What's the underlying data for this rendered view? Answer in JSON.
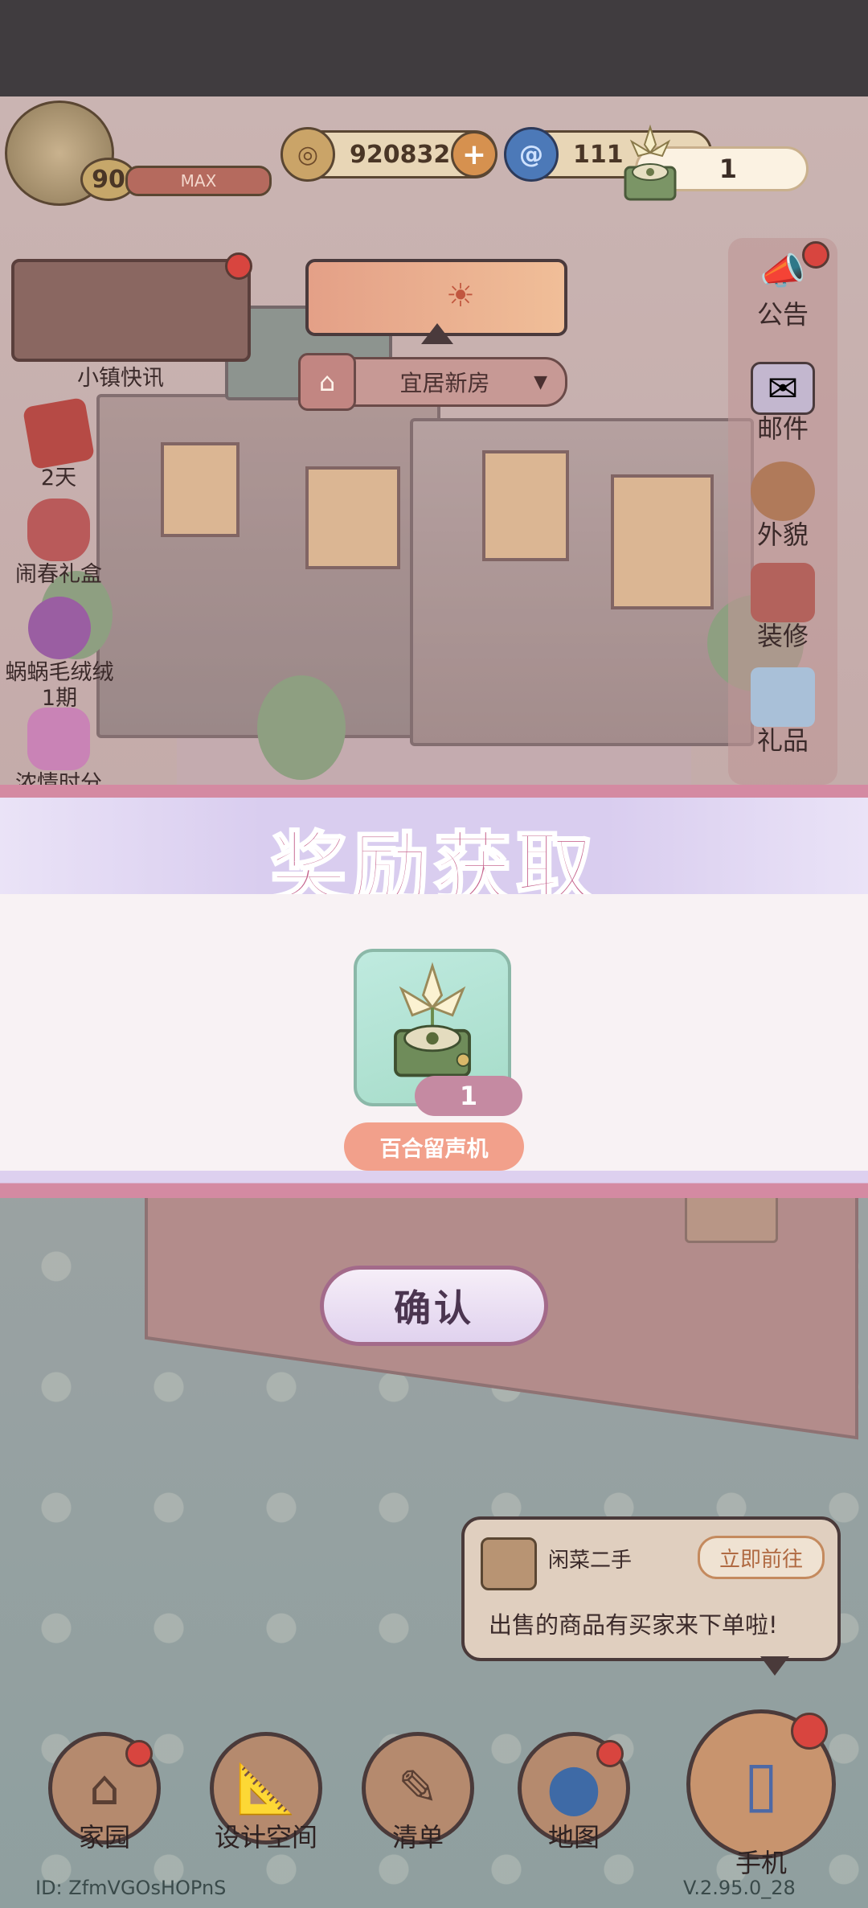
{
  "topbar": {
    "level": "90",
    "xp_label": "MAX",
    "coins": "920832",
    "gems": "111",
    "reward_chip_count": "1"
  },
  "left": {
    "news_label": "小镇快讯",
    "items": [
      {
        "label": "2天"
      },
      {
        "label": "闹春礼盒"
      },
      {
        "label": "蜗蜗毛绒绒"
      },
      {
        "label": "1期"
      },
      {
        "label": "浓情时分"
      }
    ]
  },
  "house_selector": {
    "label": "宜居新房"
  },
  "right": {
    "items": [
      {
        "label": "公告",
        "icon": "megaphone-icon"
      },
      {
        "label": "邮件",
        "icon": "mail-icon"
      },
      {
        "label": "外貌",
        "icon": "avatar-icon"
      },
      {
        "label": "装修",
        "icon": "hammer-icon"
      },
      {
        "label": "礼品",
        "icon": "gift-icon"
      }
    ]
  },
  "modal": {
    "title": "奖励获取",
    "item_count": "1",
    "item_name": "百合留声机",
    "confirm_label": "确认"
  },
  "market": {
    "name": "闲菜二手",
    "go_label": "立即前往",
    "message": "出售的商品有买家来下单啦!"
  },
  "nav": {
    "items": [
      {
        "label": "家园"
      },
      {
        "label": "设计空间"
      },
      {
        "label": "清单"
      },
      {
        "label": "地图"
      },
      {
        "label": "手机"
      }
    ]
  },
  "footer": {
    "id": "ID:  ZfmVGOsHOPnS",
    "version": "V.2.95.0_28"
  },
  "colors": {
    "modal_title": "#c6658e",
    "modal_border": "#d48aa2",
    "item_name_bg": "#f2a08b",
    "notification_dot": "#d8453f"
  }
}
